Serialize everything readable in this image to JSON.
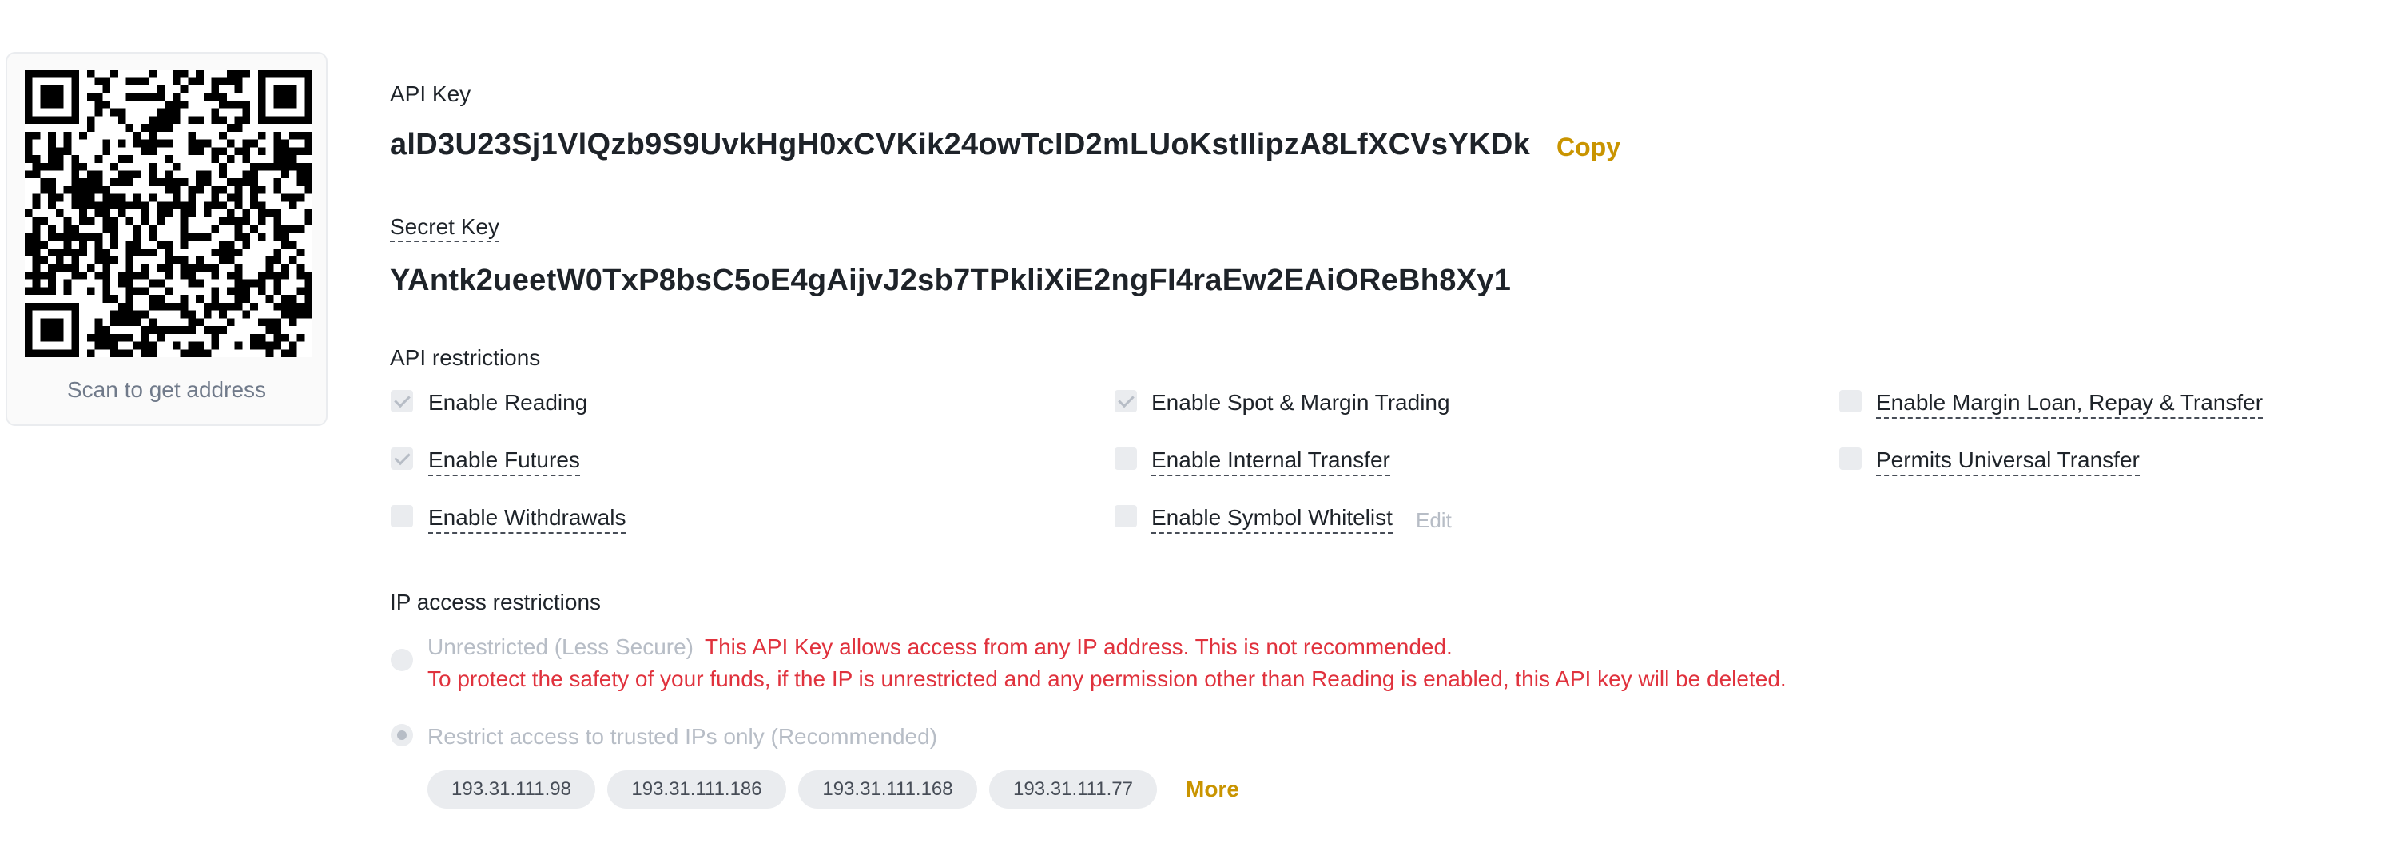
{
  "qr": {
    "caption": "Scan to get address"
  },
  "api_key": {
    "label": "API Key",
    "value": "alD3U23Sj1VlQzb9S9UvkHgH0xCVKik24owTcID2mLUoKstIIipzA8LfXCVsYKDk",
    "copy_label": "Copy"
  },
  "secret_key": {
    "label": "Secret Key",
    "value": "YAntk2ueetW0TxP8bsC5oE4gAijvJ2sb7TPkliXiE2ngFI4raEw2EAiOReBh8Xy1"
  },
  "api_restrictions": {
    "heading": "API restrictions",
    "items": [
      {
        "label": "Enable Reading",
        "checked": true
      },
      {
        "label": "Enable Spot & Margin Trading",
        "checked": true
      },
      {
        "label": "Enable Margin Loan, Repay & Transfer",
        "checked": false
      },
      {
        "label": "Enable Futures",
        "checked": true
      },
      {
        "label": "Enable Internal Transfer",
        "checked": false
      },
      {
        "label": "Permits Universal Transfer",
        "checked": false
      },
      {
        "label": "Enable Withdrawals",
        "checked": false
      },
      {
        "label": "Enable Symbol Whitelist",
        "checked": false
      }
    ],
    "edit_label": "Edit"
  },
  "ip_restrictions": {
    "heading": "IP access restrictions",
    "unrestricted_label": "Unrestricted (Less Secure)",
    "warning_line1": "This API Key allows access from any IP address. This is not recommended.",
    "warning_line2": "To protect the safety of your funds, if the IP is unrestricted and any permission other than Reading is enabled, this API key will be deleted.",
    "restricted_label": "Restrict access to trusted IPs only (Recommended)",
    "selected": "restricted",
    "ips": [
      "193.31.111.98",
      "193.31.111.186",
      "193.31.111.168",
      "193.31.111.77"
    ],
    "more_label": "More"
  },
  "colors": {
    "accent": "#c99400",
    "warning": "#e0323d",
    "disabled": "#b7bdc6"
  }
}
